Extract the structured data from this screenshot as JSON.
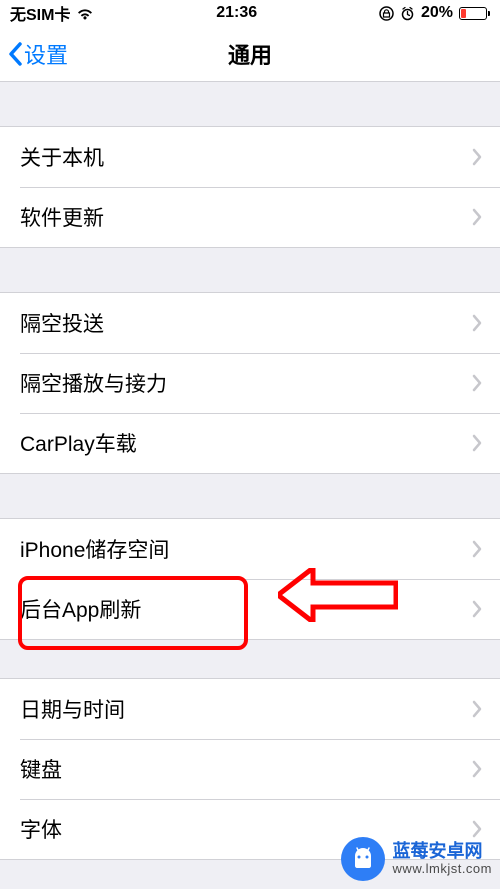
{
  "status": {
    "carrier": "无SIM卡",
    "time": "21:36",
    "battery_text": "20%",
    "battery_level": 0.2
  },
  "nav": {
    "back_label": "设置",
    "title": "通用"
  },
  "groups": [
    {
      "items": [
        {
          "key": "about",
          "label": "关于本机"
        },
        {
          "key": "software-update",
          "label": "软件更新"
        }
      ]
    },
    {
      "items": [
        {
          "key": "airdrop",
          "label": "隔空投送"
        },
        {
          "key": "airplay-handoff",
          "label": "隔空播放与接力"
        },
        {
          "key": "carplay",
          "label": "CarPlay车载"
        }
      ]
    },
    {
      "items": [
        {
          "key": "iphone-storage",
          "label": "iPhone储存空间"
        },
        {
          "key": "background-app-refresh",
          "label": "后台App刷新"
        }
      ]
    },
    {
      "items": [
        {
          "key": "date-time",
          "label": "日期与时间"
        },
        {
          "key": "keyboard",
          "label": "键盘"
        },
        {
          "key": "fonts",
          "label": "字体"
        }
      ]
    }
  ],
  "highlight": {
    "target": "background-app-refresh"
  },
  "watermark": {
    "title": "蓝莓安卓网",
    "url": "www.lmkjst.com"
  }
}
